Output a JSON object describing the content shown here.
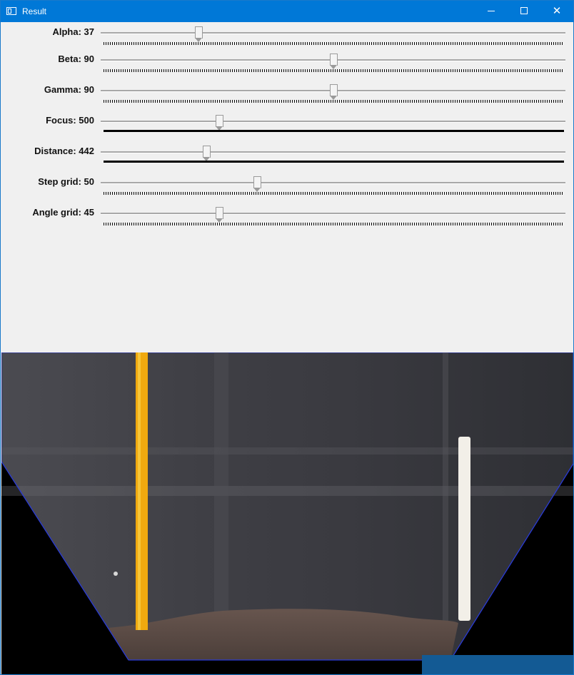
{
  "window": {
    "title": "Result",
    "accent": "#0078d7"
  },
  "titlebar_buttons": {
    "minimize_icon": "minimize-icon",
    "maximize_icon": "maximize-icon",
    "close_icon": "close-icon",
    "close_glyph": "✕"
  },
  "trackbars": [
    {
      "label": "Alpha: 37",
      "value": 37,
      "max": 180
    },
    {
      "label": "Beta: 90",
      "value": 90,
      "max": 180
    },
    {
      "label": "Gamma: 90",
      "value": 90,
      "max": 180
    },
    {
      "label": "Focus: 500",
      "value": 500,
      "max": 1900
    },
    {
      "label": "Distance: 442",
      "value": 442,
      "max": 2200
    },
    {
      "label": "Step grid: 50",
      "value": 50,
      "max": 150
    },
    {
      "label": "Angle grid: 45",
      "value": 45,
      "max": 180
    }
  ],
  "camera_view": {
    "description_colors": {
      "wall": "#3f3f44",
      "floor": "#5a4b45",
      "yellow_pole": "#f0a90f",
      "white_pole": "#f2efe8",
      "background": "#000000"
    }
  }
}
